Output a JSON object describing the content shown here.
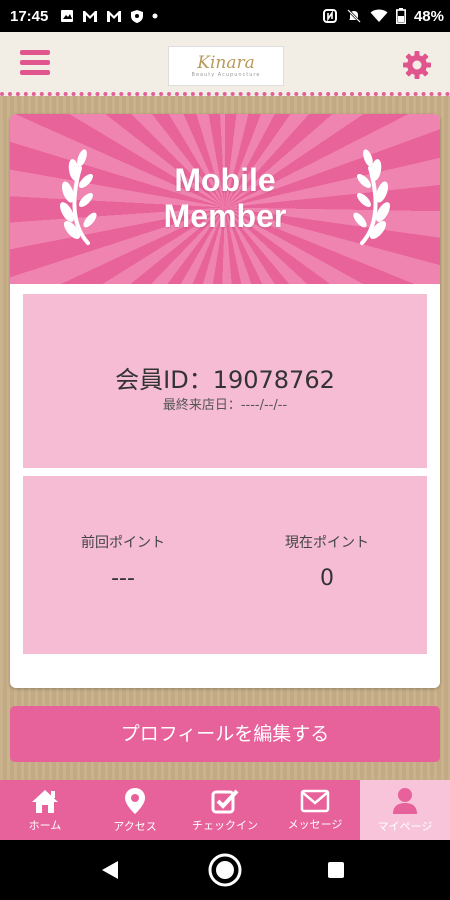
{
  "status_bar": {
    "time": "17:45",
    "battery": "48%",
    "left_icons": [
      "image-icon",
      "gmail-icon",
      "gmail-icon",
      "shield-icon",
      "dot-icon"
    ],
    "right_icons": [
      "nfc-icon",
      "mute-icon",
      "wifi-icon",
      "battery-icon"
    ]
  },
  "header": {
    "logo_text": "Kinara",
    "logo_subtext": "Beauty Acupuncture",
    "accent_color": "#e7619a"
  },
  "banner": {
    "title_line1": "Mobile",
    "title_line2": "Member"
  },
  "member": {
    "id_text": "会員ID：19078762",
    "last_visit_text": "最終来店日：----/--/--"
  },
  "points": {
    "previous_label": "前回ポイント",
    "previous_value": "---",
    "current_label": "現在ポイント",
    "current_value": "0"
  },
  "edit_button": {
    "label": "プロフィールを編集する"
  },
  "tabs": [
    {
      "label": "ホーム",
      "icon": "home-icon"
    },
    {
      "label": "アクセス",
      "icon": "map-pin-icon"
    },
    {
      "label": "チェックイン",
      "icon": "checkbox-icon"
    },
    {
      "label": "メッセージ",
      "icon": "mail-icon"
    },
    {
      "label": "マイページ",
      "icon": "user-icon",
      "active": true
    }
  ]
}
